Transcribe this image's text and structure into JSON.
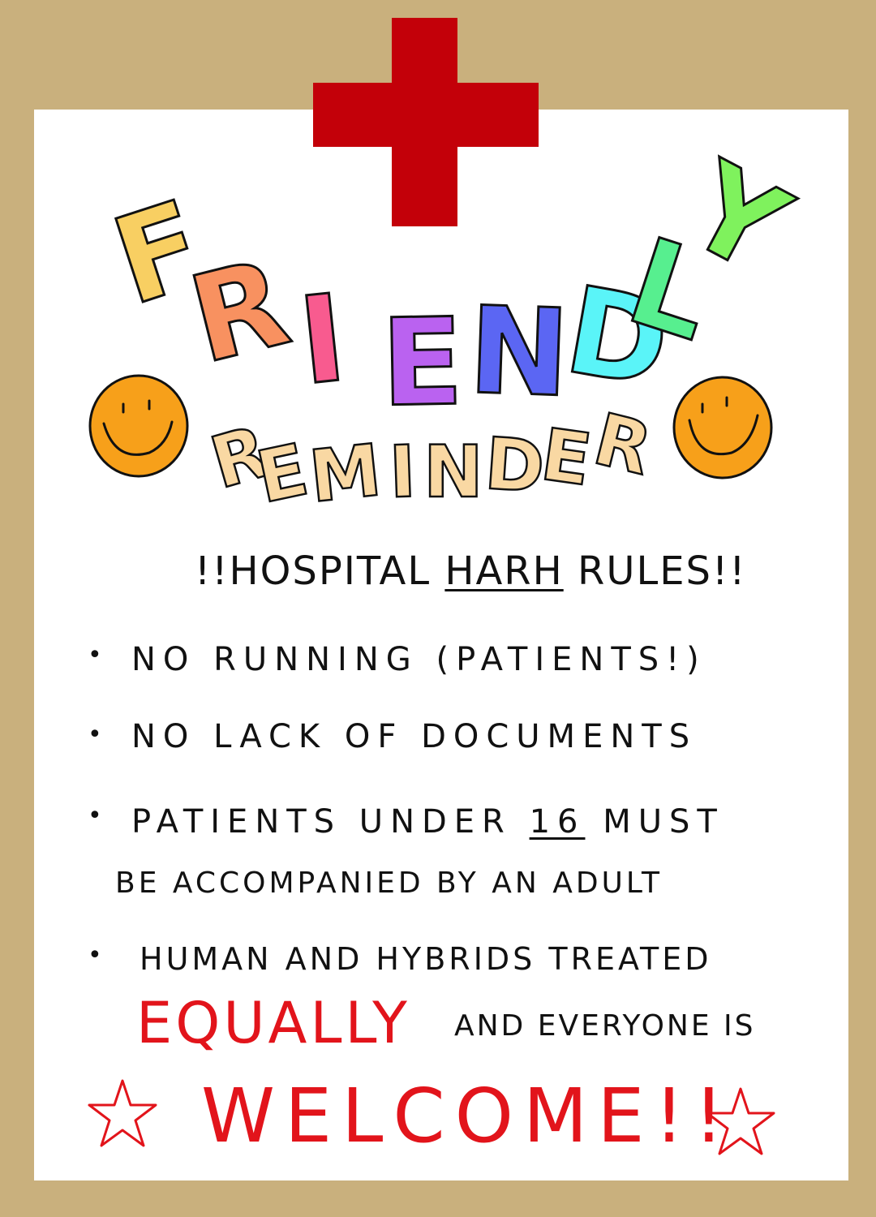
{
  "title": {
    "word1": [
      "F",
      "R",
      "I",
      "E",
      "N",
      "D",
      "L",
      "Y"
    ],
    "word2": [
      "R",
      "E",
      "M",
      "I",
      "N",
      "D",
      "E",
      "R"
    ],
    "letter_colors": [
      "#f8cf62",
      "#f89160",
      "#f85b8f",
      "#ba62f0",
      "#5b66f3",
      "#5af4f8",
      "#57ef8f",
      "#7ff25d"
    ],
    "reminder_color": "#fad8a2"
  },
  "heading": {
    "prefix": "!!HOSPITAL ",
    "emphasis": "HARH",
    "suffix": " RULES!!"
  },
  "rules": [
    {
      "text": "NO RUNNING (PATIENTS!)"
    },
    {
      "text": "NO LACK OF DOCUMENTS"
    },
    {
      "line1_prefix": "PATIENTS UNDER ",
      "line1_emphasis": "16",
      "line1_suffix": " MUST",
      "line2": "BE ACCOMPANIED BY AN ADULT"
    },
    {
      "line1": "HUMAN AND HYBRIDS TREATED",
      "line2_emphasis": "EQUALLY",
      "line2_suffix": "AND EVERYONE IS"
    }
  ],
  "closing": "WELCOME!!",
  "colors": {
    "background": "#c9b07d",
    "paper": "#ffffff",
    "cross": "#c30009",
    "red_text": "#e2141b",
    "smiley": "#f7a01a"
  },
  "icons": [
    "medical-cross-icon",
    "smiley-face-icon",
    "star-icon"
  ]
}
